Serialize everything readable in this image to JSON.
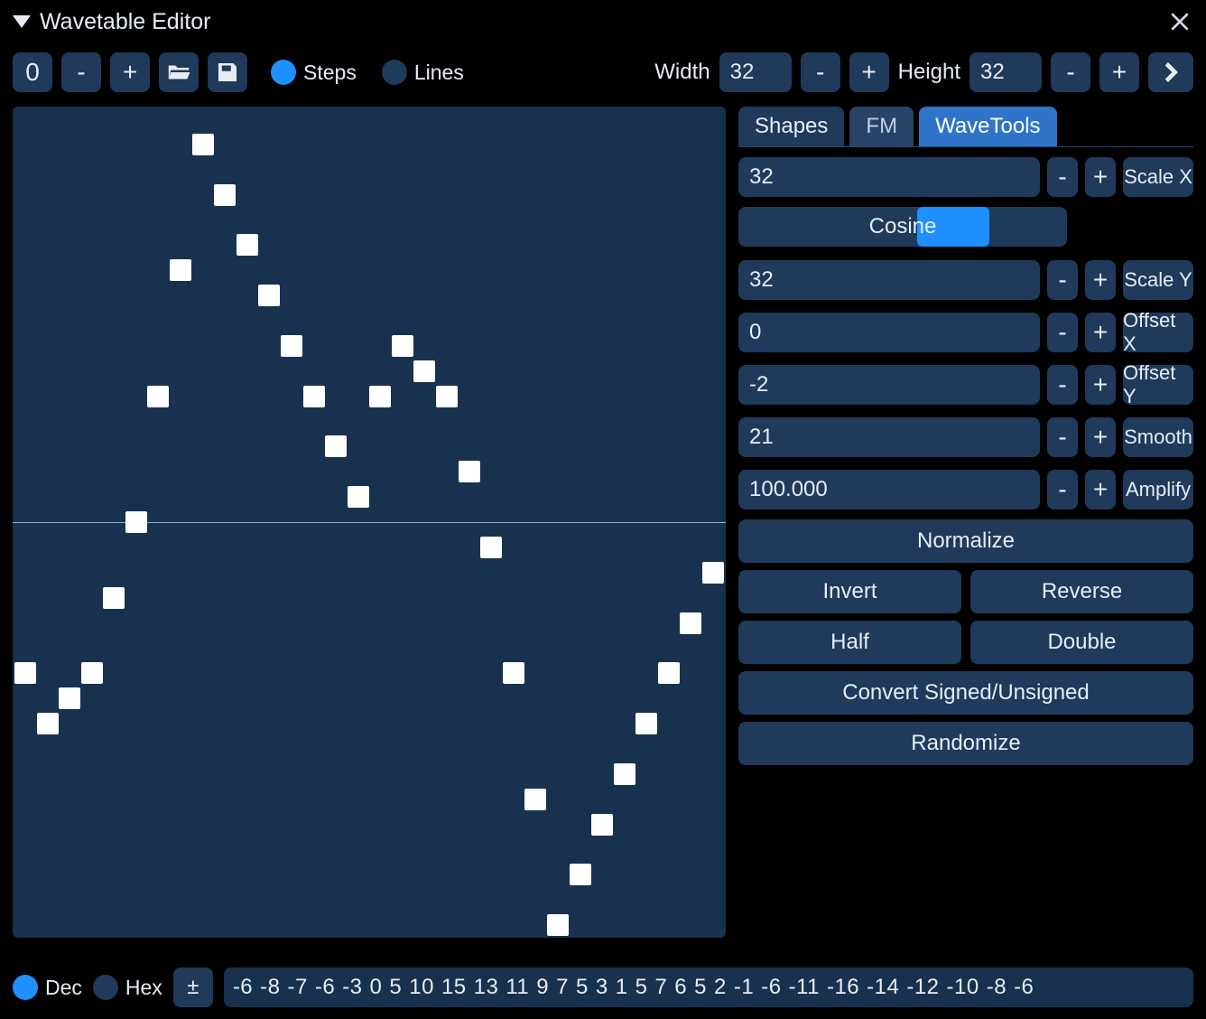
{
  "title": "Wavetable Editor",
  "toolbar": {
    "slot": "0",
    "minus": "-",
    "plus": "+",
    "steps_label": "Steps",
    "lines_label": "Lines",
    "width_label": "Width",
    "width_value": "32",
    "height_label": "Height",
    "height_value": "32"
  },
  "tabs": {
    "shapes": "Shapes",
    "fm": "FM",
    "wavetools": "WaveTools",
    "active": "wavetools"
  },
  "wavetools": {
    "scale_x": {
      "value": "32",
      "label": "Scale X"
    },
    "cosine_label": "Cosine",
    "scale_y": {
      "value": "32",
      "label": "Scale Y"
    },
    "offset_x": {
      "value": "0",
      "label": "Offset X"
    },
    "offset_y": {
      "value": "-2",
      "label": "Offset Y"
    },
    "smooth": {
      "value": "21",
      "label": "Smooth"
    },
    "amplify": {
      "value": "100.000",
      "label": "Amplify"
    },
    "normalize": "Normalize",
    "invert": "Invert",
    "reverse": "Reverse",
    "half": "Half",
    "double": "Double",
    "convert": "Convert Signed/Unsigned",
    "randomize": "Randomize"
  },
  "footer": {
    "dec_label": "Dec",
    "hex_label": "Hex",
    "plusminus": "±",
    "sequence": [
      "-6",
      "-8",
      "-7",
      "-6",
      "-3",
      "0",
      "5",
      "10",
      "15",
      "13",
      "11",
      "9",
      "7",
      "5",
      "3",
      "1",
      "5",
      "7",
      "6",
      "5",
      "2",
      "-1",
      "-6",
      "-11",
      "-16",
      "-14",
      "-12",
      "-10",
      "-8",
      "-6"
    ]
  },
  "chart_data": {
    "type": "scatter",
    "title": "Wavetable Editor",
    "width": 32,
    "height": 32,
    "x": [
      0,
      1,
      2,
      3,
      4,
      5,
      6,
      7,
      8,
      9,
      10,
      11,
      12,
      13,
      14,
      15,
      16,
      17,
      18,
      19,
      20,
      21,
      22,
      23,
      24,
      25,
      26,
      27,
      28,
      29,
      30,
      31
    ],
    "values": [
      -6,
      -8,
      -7,
      -6,
      -3,
      0,
      5,
      10,
      15,
      13,
      11,
      9,
      7,
      5,
      3,
      1,
      5,
      7,
      6,
      5,
      2,
      -1,
      -6,
      -11,
      -16,
      -14,
      -12,
      -10,
      -8,
      -6,
      -4,
      -2
    ],
    "xlim": [
      0,
      31
    ],
    "ylim": [
      -16,
      16
    ],
    "xlabel": "",
    "ylabel": "",
    "legend": false
  }
}
